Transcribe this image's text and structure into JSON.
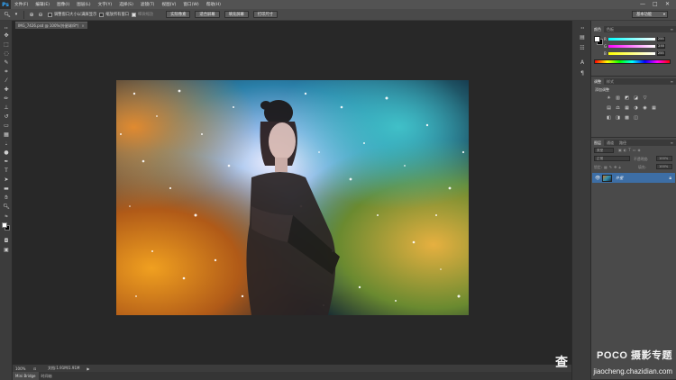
{
  "app": {
    "logo": "Ps"
  },
  "menu": [
    "文件(F)",
    "编辑(E)",
    "图像(I)",
    "图层(L)",
    "文字(Y)",
    "选择(S)",
    "滤镜(T)",
    "视图(V)",
    "窗口(W)",
    "帮助(H)"
  ],
  "window_controls": [
    "—",
    "□",
    "✕"
  ],
  "options": {
    "tool_icon": "zoom-icon",
    "check_resize": "调整窗口大小以满屏显示",
    "check_all_windows": "缩放所有窗口",
    "check_scrubby": "细微缩放",
    "btn_actual": "实际像素",
    "btn_fit": "适合屏幕",
    "btn_fill": "填充屏幕",
    "btn_print": "打印尺寸",
    "workspace": "基本功能"
  },
  "document": {
    "tab_title": "IMG_7426.psd @ 100%(外星球/8*)"
  },
  "status": {
    "zoom": "100%",
    "doc_size": "文档:1.91M/1.91M"
  },
  "mini_bridge": {
    "tabs": [
      "Mini Bridge",
      "时间轴"
    ]
  },
  "panels": {
    "color": {
      "tabs": [
        "颜色",
        "色板"
      ],
      "r_label": "R",
      "g_label": "G",
      "b_label": "B",
      "r": "255",
      "g": "255",
      "b": "255",
      "fg_hex": "#ffffff"
    },
    "adjustments": {
      "tabs": [
        "调整",
        "样式"
      ],
      "hint": "添加调整",
      "row1": [
        "☀",
        "▥",
        "◩",
        "◪",
        "▽"
      ],
      "row2": [
        "▤",
        "⚖",
        "▦",
        "◑",
        "◉",
        "▦"
      ],
      "row3": [
        "◧",
        "◨",
        "▩",
        "◫"
      ]
    },
    "layers": {
      "tabs": [
        "图层",
        "通道",
        "路径"
      ],
      "filter_label": "类型",
      "blend_mode": "正常",
      "opacity_label": "不透明度:",
      "opacity_value": "100%",
      "lock_label": "锁定:",
      "fill_label": "填充:",
      "fill_value": "100%",
      "layer_name": "外星"
    }
  },
  "watermark": {
    "big": "查",
    "line1": "POCO 摄影专题",
    "line2": "jiaocheng.chazidian.com"
  }
}
